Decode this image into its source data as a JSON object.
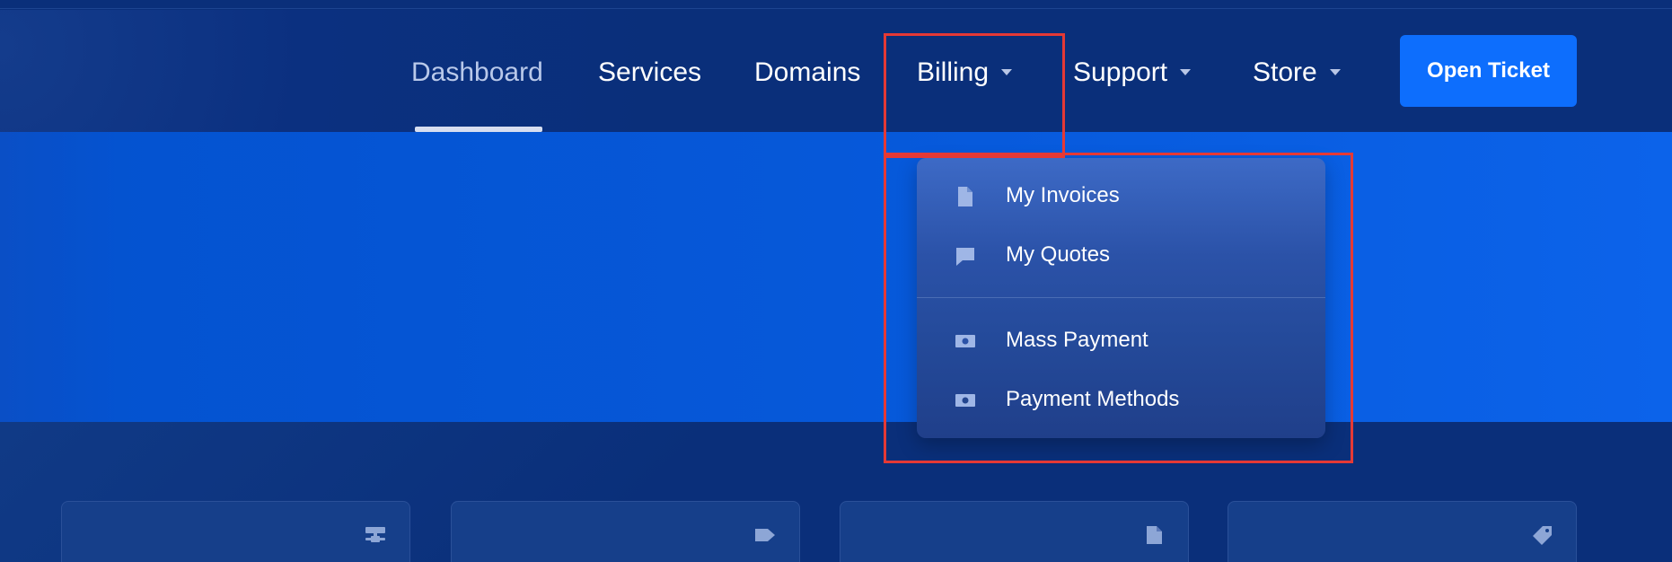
{
  "nav": {
    "items": [
      {
        "label": "Dashboard",
        "active": true,
        "has_caret": false
      },
      {
        "label": "Services",
        "active": false,
        "has_caret": false
      },
      {
        "label": "Domains",
        "active": false,
        "has_caret": false
      },
      {
        "label": "Billing",
        "active": false,
        "has_caret": true
      },
      {
        "label": "Support",
        "active": false,
        "has_caret": true
      },
      {
        "label": "Store",
        "active": false,
        "has_caret": true
      }
    ],
    "cta_label": "Open Ticket"
  },
  "billing_dropdown": {
    "items": [
      {
        "label": "My Invoices",
        "icon": "file-icon"
      },
      {
        "label": "My Quotes",
        "icon": "comment-icon"
      },
      {
        "label": "Mass Payment",
        "icon": "money-bill-icon"
      },
      {
        "label": "Payment Methods",
        "icon": "money-bill-icon"
      }
    ]
  },
  "cards": [
    {
      "icon": "server-icon"
    },
    {
      "icon": "tag-icon"
    },
    {
      "icon": "file-icon"
    },
    {
      "icon": "tag-diagonal-icon"
    }
  ],
  "colors": {
    "header_bg": "#0a2f7a",
    "hero_bg": "#0658d9",
    "cta_bg": "#0d6efd",
    "highlight": "#e53935"
  }
}
